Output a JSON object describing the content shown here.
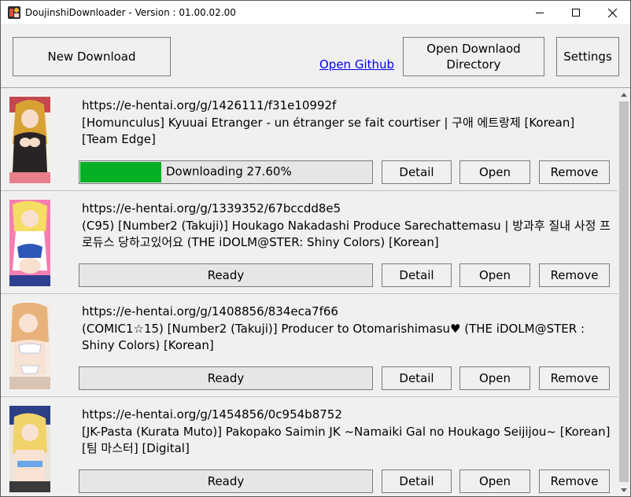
{
  "window": {
    "title": "DoujinshiDownloader - Version : 01.00.02.00",
    "controls": {
      "minimize": "minimize-icon",
      "maximize": "maximize-icon",
      "close": "close-icon"
    }
  },
  "toolbar": {
    "new_download": "New Download",
    "open_github": "Open Github",
    "open_directory": "Open Downlaod Directory",
    "settings": "Settings"
  },
  "colors": {
    "progress": "#06b025",
    "link": "#0000ee"
  },
  "items": [
    {
      "url": "https://e-hentai.org/g/1426111/f31e10992f",
      "title": "[Homunculus] Kyuuai Etranger - un étranger se fait courtiser | 구애 에트랑제 [Korean] [Team Edge]",
      "status": "Downloading 27.60%",
      "progress": 27.6,
      "detail": "Detail",
      "open": "Open",
      "remove": "Remove"
    },
    {
      "url": "https://e-hentai.org/g/1339352/67bccdd8e5",
      "title": "(C95) [Number2 (Takuji)] Houkago Nakadashi Produce Sarechattemasu | 방과후 질내 사정 프로듀스 당하고있어요 (THE iDOLM@STER: Shiny Colors) [Korean]",
      "status": "Ready",
      "progress": null,
      "detail": "Detail",
      "open": "Open",
      "remove": "Remove"
    },
    {
      "url": "https://e-hentai.org/g/1408856/834eca7f66",
      "title": "(COMIC1☆15) [Number2 (Takuji)] Producer to Otomarishimasu♥ (THE iDOLM@STER : Shiny Colors) [Korean]",
      "status": "Ready",
      "progress": null,
      "detail": "Detail",
      "open": "Open",
      "remove": "Remove"
    },
    {
      "url": "https://e-hentai.org/g/1454856/0c954b8752",
      "title": "[JK-Pasta (Kurata Muto)] Pakopako Saimin JK ~Namaiki Gal no Houkago Seijijou~ [Korean] [팀 마스터] [Digital]",
      "status": "Ready",
      "progress": null,
      "detail": "Detail",
      "open": "Open",
      "remove": "Remove"
    }
  ]
}
